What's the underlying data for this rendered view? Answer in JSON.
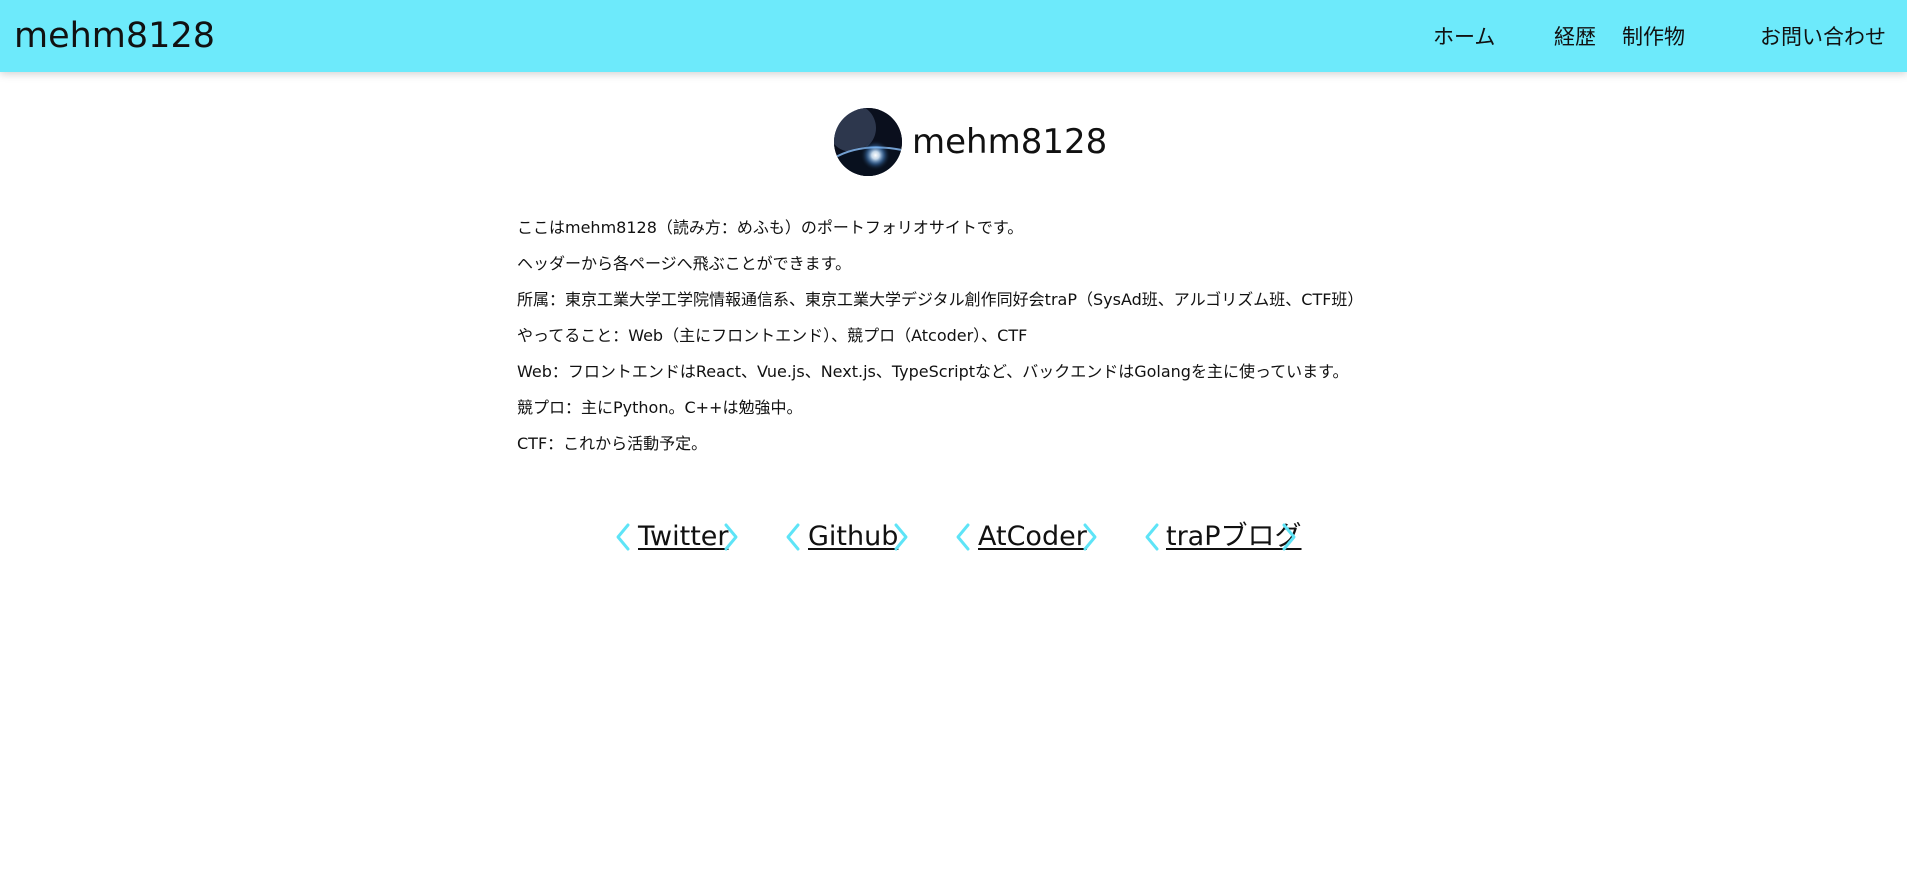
{
  "header": {
    "site_title": "mehm8128",
    "nav": [
      {
        "label": "ホーム"
      },
      {
        "label": "経歴"
      },
      {
        "label": "制作物"
      },
      {
        "label": "お問い合わせ"
      }
    ]
  },
  "profile": {
    "name": "mehm8128",
    "avatar_icon": "earth-avatar"
  },
  "intro": {
    "lines": [
      "ここはmehm8128（読み方：めふも）のポートフォリオサイトです。",
      "ヘッダーから各ページへ飛ぶことができます。",
      "所属：東京工業大学工学院情報通信系、東京工業大学デジタル創作同好会traP（SysAd班、アルゴリズム班、CTF班）",
      "やってること：Web（主にフロントエンド）、競プロ（Atcoder）、CTF",
      "Web：フロントエンドはReact、Vue.js、Next.js、TypeScriptなど、バックエンドはGolangを主に使っています。",
      "競プロ：主にPython。C++は勉強中。",
      "CTF：これから活動予定。"
    ]
  },
  "links": [
    {
      "label": "Twitter"
    },
    {
      "label": "Github"
    },
    {
      "label": "AtCoder"
    },
    {
      "label": "traPブログ"
    }
  ],
  "colors": {
    "header_bg": "#6deafb",
    "chevron": "#5ee4f7",
    "text": "#111111"
  }
}
